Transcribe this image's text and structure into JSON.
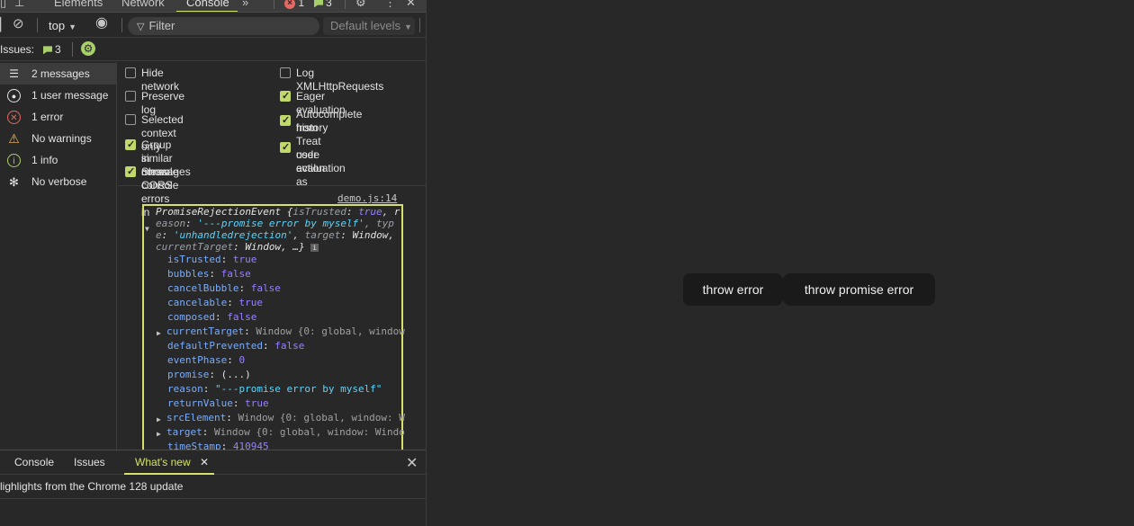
{
  "devtools": {
    "tabs": [
      "Elements",
      "Network",
      "Console"
    ],
    "active_tab": "Console",
    "error_count": "1",
    "issue_count": "3",
    "toolbar": {
      "context": "top",
      "filter_placeholder": "Filter",
      "levels": "Default levels"
    },
    "issues_bar": {
      "label": "Issues:",
      "count": "3"
    },
    "sidebar": [
      {
        "label": "2 messages",
        "icon": "list-icon",
        "selected": true
      },
      {
        "label": "1 user message",
        "icon": "user-circle-icon"
      },
      {
        "label": "1 error",
        "icon": "error-icon"
      },
      {
        "label": "No warnings",
        "icon": "warning-icon"
      },
      {
        "label": "1 info",
        "icon": "info-icon"
      },
      {
        "label": "No verbose",
        "icon": "bug-icon"
      }
    ],
    "settings": {
      "hide_network": {
        "label": "Hide network",
        "checked": false
      },
      "preserve_log": {
        "label": "Preserve log",
        "checked": false
      },
      "selected_context": {
        "label": "Selected context only",
        "checked": false
      },
      "group_similar_1": "Group similar messages",
      "group_similar_2": "in console",
      "group_similar_checked": true,
      "show_cors_1": "Show CORS errors in",
      "show_cors_2": "console",
      "show_cors_checked": true,
      "log_xhr": {
        "label": "Log XMLHttpRequests",
        "checked": false
      },
      "eager_eval": {
        "label": "Eager evaluation",
        "checked": true
      },
      "autocomplete_1": "Autocomplete from",
      "autocomplete_2": "history",
      "autocomplete_checked": true,
      "treat_code_1": "Treat code evaluation as",
      "treat_code_2": "user action",
      "treat_code_checked": true
    },
    "output": {
      "source_link": "demo.js:14",
      "summary": {
        "l1_name": "PromiseRejectionEvent {",
        "l1_key": "isTrusted",
        "l1_val": "true",
        "l1_tail": ", r",
        "l2_key": "eason",
        "l2_val": "'---promise error by myself'",
        "l2_tail": ", typ",
        "l3_key": "e",
        "l3_val": "'unhandledrejection'",
        "l3_k2": "target",
        "l3_v2": "Window,",
        "l4_key": "currentTarget",
        "l4_val": "Window, …}",
        "info_glyph": "i"
      },
      "props": [
        {
          "key": "isTrusted",
          "val": "true",
          "kind": "bool"
        },
        {
          "key": "bubbles",
          "val": "false",
          "kind": "bool"
        },
        {
          "key": "cancelBubble",
          "val": "false",
          "kind": "bool"
        },
        {
          "key": "cancelable",
          "val": "true",
          "kind": "bool"
        },
        {
          "key": "composed",
          "val": "false",
          "kind": "bool"
        },
        {
          "key": "currentTarget",
          "val": "Window {0: global, window",
          "kind": "obj",
          "expandable": true
        },
        {
          "key": "defaultPrevented",
          "val": "false",
          "kind": "bool"
        },
        {
          "key": "eventPhase",
          "val": "0",
          "kind": "num"
        },
        {
          "key": "promise",
          "val": "(...)",
          "kind": "plain"
        },
        {
          "key": "reason",
          "val": "\"---promise error by myself\"",
          "kind": "str"
        },
        {
          "key": "returnValue",
          "val": "true",
          "kind": "bool"
        },
        {
          "key": "srcElement",
          "val": "Window {0: global, window: W",
          "kind": "obj",
          "expandable": true
        },
        {
          "key": "target",
          "val": "Window {0: global, window: Windo",
          "kind": "obj",
          "expandable": true
        },
        {
          "key": "timeStamp",
          "val": "410945",
          "kind": "num"
        }
      ]
    },
    "drawer": {
      "tabs": [
        "Console",
        "Issues",
        "What's new"
      ],
      "active": "What's new",
      "highlight": "lighlights from the Chrome 128 update"
    }
  },
  "page": {
    "buttons": [
      "throw error",
      "throw promise error"
    ]
  },
  "colors": {
    "accent": "#d6e06a",
    "error": "#e46962",
    "issue": "#a8d06a",
    "panel_bg": "#282828"
  }
}
